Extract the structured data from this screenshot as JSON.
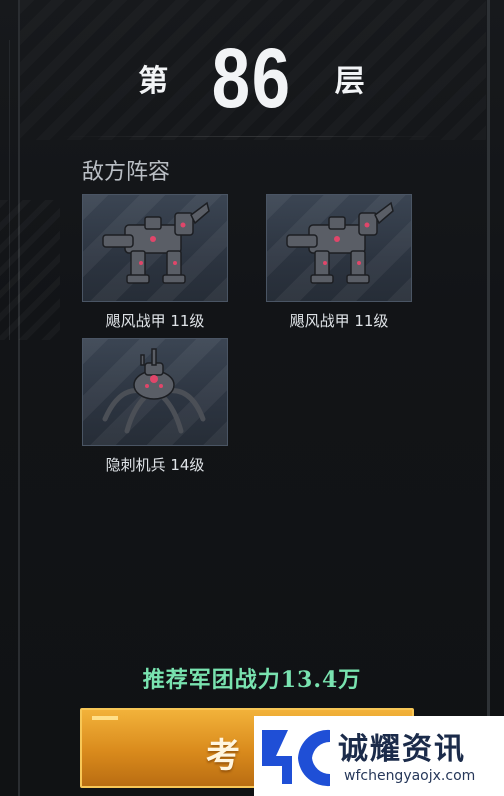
{
  "floor": {
    "prefix": "第",
    "number": "86",
    "suffix": "层"
  },
  "enemy_section": {
    "title": "敌方阵容",
    "enemies": [
      {
        "name": "飓风战甲 11级",
        "icon": "mech-walker-icon"
      },
      {
        "name": "飓风战甲 11级",
        "icon": "mech-walker-icon"
      },
      {
        "name": "隐刺机兵 14级",
        "icon": "spider-drone-icon"
      }
    ]
  },
  "recommended_power": "推荐军团战力13.4万",
  "challenge_button": {
    "label": "考"
  },
  "watermark": {
    "name": "诚耀资讯",
    "url": "wfchengyaojx.com"
  },
  "colors": {
    "power_text": "#79e3b0",
    "button": "#e39a25",
    "card_bg": "#2f3845",
    "watermark_blue": "#1f4fd6"
  }
}
